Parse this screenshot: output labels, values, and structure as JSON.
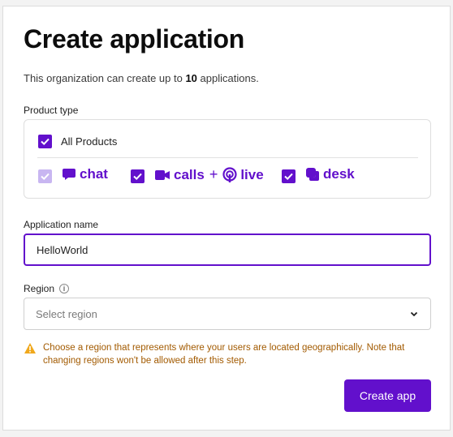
{
  "page": {
    "title": "Create application",
    "limit_prefix": "This organization can create up to ",
    "limit_count": "10",
    "limit_suffix": " applications."
  },
  "product_type": {
    "label": "Product type",
    "all_products": {
      "label": "All Products",
      "checked": true
    },
    "items": [
      {
        "label": "chat",
        "icon": "chat-bubble-icon",
        "checked": true,
        "disabled": true
      },
      {
        "label": "calls",
        "joiner": "+",
        "label2": "live",
        "icon": "video-icon",
        "icon2": "live-broadcast-icon",
        "checked": true,
        "disabled": false
      },
      {
        "label": "desk",
        "icon": "desk-icon",
        "checked": true,
        "disabled": false
      }
    ]
  },
  "app_name": {
    "label": "Application name",
    "value": "HelloWorld"
  },
  "region": {
    "label": "Region",
    "info_icon": "info-icon",
    "placeholder": "Select region",
    "chevron_icon": "chevron-down-icon"
  },
  "warning": {
    "icon": "warning-triangle-icon",
    "text": "Choose a region that represents where your users are located geographically. Note that changing regions won't be allowed after this step."
  },
  "actions": {
    "create_label": "Create app"
  },
  "colors": {
    "accent": "#6210cc",
    "accent_disabled": "#c8b6f1",
    "warning_text": "#a25a00",
    "warning_icon": "#f0a81c"
  }
}
